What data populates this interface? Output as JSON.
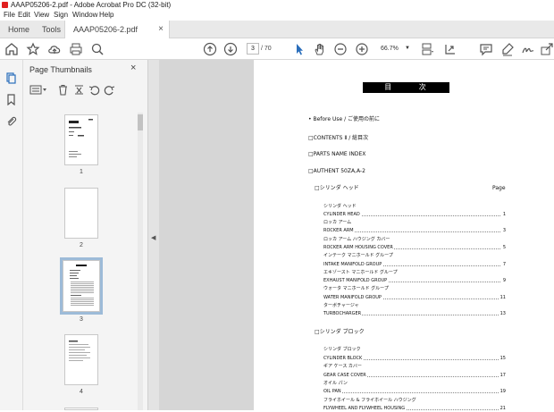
{
  "window": {
    "title": "AAAP05206-2.pdf - Adobe Acrobat Pro DC (32-bit)"
  },
  "menu": [
    "File",
    "Edit",
    "View",
    "Sign",
    "Window",
    "Help"
  ],
  "tabs": {
    "home": "Home",
    "tools": "Tools",
    "document": "AAAP05206-2.pdf",
    "close": "×"
  },
  "toolbar": {
    "current_page": "3",
    "total_pages": "/ 70",
    "zoom": "66.7%"
  },
  "thumbnails": {
    "header": "Page Thumbnails",
    "close": "×",
    "pages": [
      "1",
      "2",
      "3",
      "4"
    ],
    "selected": "3"
  },
  "document": {
    "heading": "目 次",
    "intro": [
      "• Before Use / ご使用の前に",
      "□CONTENTS Ⅱ / 総目次",
      "□PARTS NAME INDEX",
      "□AUTHENT 50ZA,A-2"
    ],
    "section1": {
      "title": "□シリンダ ヘッド",
      "page_label": "Page"
    },
    "section1_entries": [
      {
        "label": "シリンダ ヘッド",
        "page": ""
      },
      {
        "label": "CYLINDER HEAD",
        "page": "1"
      },
      {
        "label": "ロッカ アーム",
        "page": ""
      },
      {
        "label": "ROCKER ARM",
        "page": "3"
      },
      {
        "label": "ロッカ アーム ハウジング カバー",
        "page": ""
      },
      {
        "label": "ROCKER ARM HOUSING COVER",
        "page": "5"
      },
      {
        "label": "インテーク マニホールド グループ",
        "page": ""
      },
      {
        "label": "INTAKE MANIFOLD GROUP",
        "page": "7"
      },
      {
        "label": "エキゾースト マニホールド グループ",
        "page": ""
      },
      {
        "label": "EXHAUST MANIFOLD GROUP",
        "page": "9"
      },
      {
        "label": "ウォータ マニホールド グループ",
        "page": ""
      },
      {
        "label": "WATER MANIFOLD GROUP",
        "page": "11"
      },
      {
        "label": "ターボチャージャ",
        "page": ""
      },
      {
        "label": "TURBOCHARGER",
        "page": "13"
      }
    ],
    "section2": {
      "title": "□シリンダ ブロック"
    },
    "section2_entries": [
      {
        "label": "シリンダ ブロック",
        "page": ""
      },
      {
        "label": "CYLINDER BLOCK",
        "page": "15"
      },
      {
        "label": "ギア ケース カバー",
        "page": ""
      },
      {
        "label": "GEAR CASE COVER",
        "page": "17"
      },
      {
        "label": "オイル パン",
        "page": ""
      },
      {
        "label": "OIL PAN",
        "page": "19"
      },
      {
        "label": "フライホイール & フライホイール ハウジング",
        "page": ""
      },
      {
        "label": "FLYWHEEL AND FLYWHEEL HOUSING",
        "page": "21"
      }
    ]
  },
  "colors": {
    "accent_blue": "#2a6ebb",
    "selection": "#9dbbd8",
    "pdf_red": "#e0201f"
  }
}
